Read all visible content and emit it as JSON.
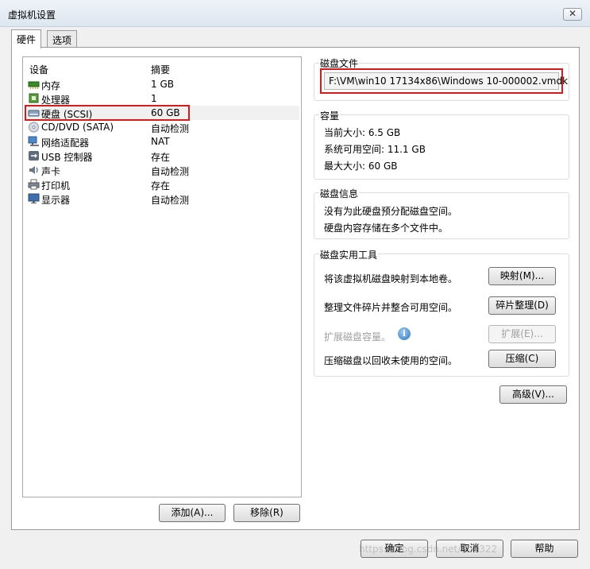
{
  "window": {
    "title": "虚拟机设置",
    "close_glyph": "✕"
  },
  "tabs": [
    {
      "label": "硬件"
    },
    {
      "label": "选项"
    }
  ],
  "device_list": {
    "header_device": "设备",
    "header_summary": "摘要",
    "items": [
      {
        "name": "内存",
        "summary": "1 GB",
        "icon": "memory-icon"
      },
      {
        "name": "处理器",
        "summary": "1",
        "icon": "processor-icon"
      },
      {
        "name": "硬盘 (SCSI)",
        "summary": "60 GB",
        "icon": "hard-disk-icon",
        "selected": true
      },
      {
        "name": "CD/DVD (SATA)",
        "summary": "自动检测",
        "icon": "cd-dvd-icon"
      },
      {
        "name": "网络适配器",
        "summary": "NAT",
        "icon": "network-adapter-icon"
      },
      {
        "name": "USB 控制器",
        "summary": "存在",
        "icon": "usb-icon"
      },
      {
        "name": "声卡",
        "summary": "自动检测",
        "icon": "sound-card-icon"
      },
      {
        "name": "打印机",
        "summary": "存在",
        "icon": "printer-icon"
      },
      {
        "name": "显示器",
        "summary": "自动检测",
        "icon": "display-icon"
      }
    ],
    "add_button": "添加(A)...",
    "remove_button": "移除(R)"
  },
  "disk_file": {
    "title": "磁盘文件",
    "path": "F:\\VM\\win10 17134x86\\Windows 10-000002.vmdk"
  },
  "capacity": {
    "title": "容量",
    "current_size": "当前大小: 6.5 GB",
    "free_space": "系统可用空间: 11.1 GB",
    "max_size": "最大大小: 60 GB"
  },
  "disk_info": {
    "title": "磁盘信息",
    "line1": "没有为此硬盘预分配磁盘空间。",
    "line2": "硬盘内容存储在多个文件中。"
  },
  "disk_utilities": {
    "title": "磁盘实用工具",
    "map_text": "将该虚拟机磁盘映射到本地卷。",
    "map_button": "映射(M)...",
    "defrag_text": "整理文件碎片并整合可用空间。",
    "defrag_button": "碎片整理(D)",
    "expand_text": "扩展磁盘容量。",
    "expand_button": "扩展(E)...",
    "compact_text": "压缩磁盘以回收未使用的空间。",
    "compact_button": "压缩(C)"
  },
  "advanced_button": "高级(V)...",
  "footer": {
    "ok": "确定",
    "cancel": "取消",
    "help": "帮助"
  },
  "watermark": "https://blog.csdn.net/nb2322"
}
